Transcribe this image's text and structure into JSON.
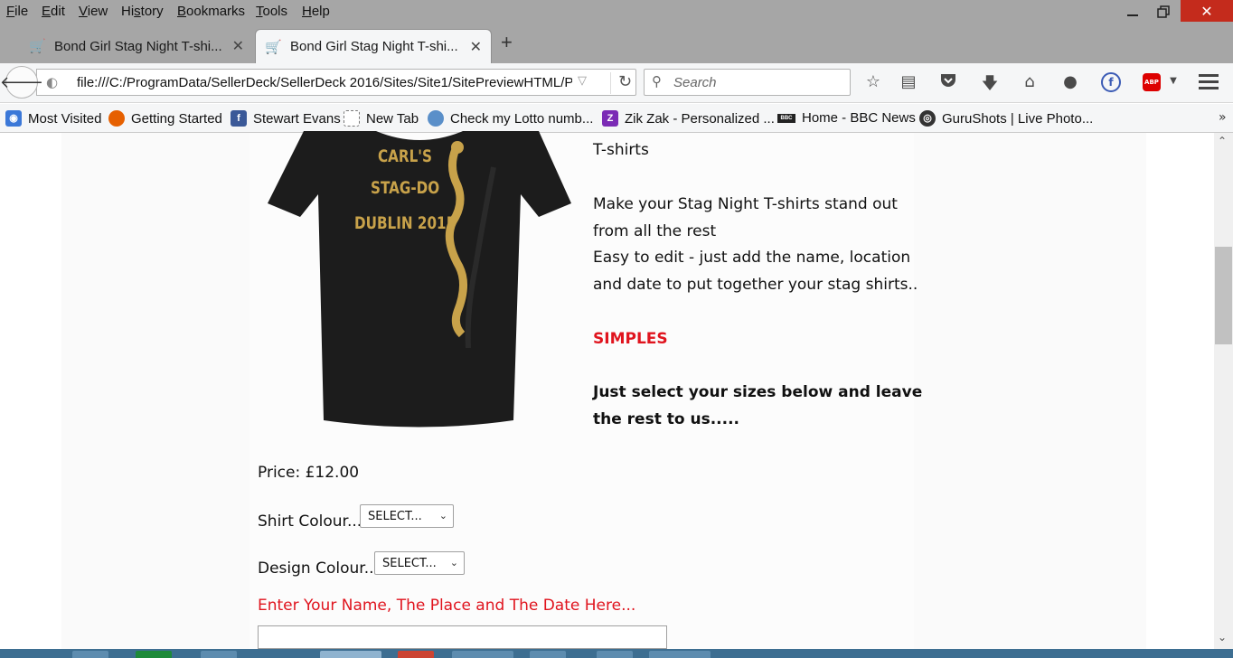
{
  "menu": {
    "items": [
      {
        "label": "File",
        "accel": "F",
        "rest": "ile"
      },
      {
        "label": "Edit",
        "accel": "E",
        "rest": "dit"
      },
      {
        "label": "View",
        "accel": "V",
        "rest": "iew"
      },
      {
        "label": "History",
        "accel": "s",
        "pre": "Hi",
        "rest": "tory"
      },
      {
        "label": "Bookmarks",
        "accel": "B",
        "rest": "ookmarks"
      },
      {
        "label": "Tools",
        "accel": "T",
        "rest": "ools"
      },
      {
        "label": "Help",
        "accel": "H",
        "rest": "elp"
      }
    ]
  },
  "tabs": [
    {
      "title": "Bond Girl Stag Night T-shi...",
      "active": false
    },
    {
      "title": "Bond Girl Stag Night T-shi...",
      "active": true
    }
  ],
  "nav": {
    "url": "file:///C:/ProgramData/SellerDeck/SellerDeck 2016/Sites/Site1/SitePreviewHTML/P",
    "search_placeholder": "Search"
  },
  "bookmarks": [
    {
      "label": "Most Visited",
      "icon": "most-visited-icon",
      "color": "#3b78d8"
    },
    {
      "label": "Getting Started",
      "icon": "firefox-icon",
      "color": "#e66000"
    },
    {
      "label": "Stewart Evans",
      "icon": "facebook-icon",
      "color": "#3b5998"
    },
    {
      "label": "New Tab",
      "icon": "blank-page-icon",
      "color": "#ffffff"
    },
    {
      "label": "Check my Lotto numb...",
      "icon": "lotto-icon",
      "color": "#5a8fc9"
    },
    {
      "label": "Zik Zak - Personalized ...",
      "icon": "zikzak-icon",
      "color": "#7b2bb5"
    },
    {
      "label": "Home - BBC News",
      "icon": "bbc-icon",
      "color": "#222222"
    },
    {
      "label": "GuruShots | Live Photo...",
      "icon": "gurushots-icon",
      "color": "#333333"
    }
  ],
  "product": {
    "shirt_text": [
      "CARL'S",
      "STAG-DO",
      "DUBLIN 2015"
    ],
    "desc_partial": "T-shirts",
    "desc_line1": "Make your Stag Night T-shirts stand out",
    "desc_line2": "from all the rest",
    "desc_line3": "Easy to edit - just add the name, location",
    "desc_line4": "and date to put together your stag shirts..",
    "simples": "SIMPLES",
    "cta_line1": "Just select your sizes below and leave",
    "cta_line2": "the rest to us.....",
    "price": "Price: £12.00",
    "shirt_colour_label": "Shirt Colour...",
    "shirt_colour_value": "SELECT...",
    "design_colour_label": "Design Colour...",
    "design_colour_value": "SELECT...",
    "name_prompt": "Enter Your Name, The Place and The Date Here..."
  },
  "colors": {
    "accent_red": "#e0141e",
    "shirt_print": "#c8a24a",
    "close_button": "#c42b1c"
  }
}
